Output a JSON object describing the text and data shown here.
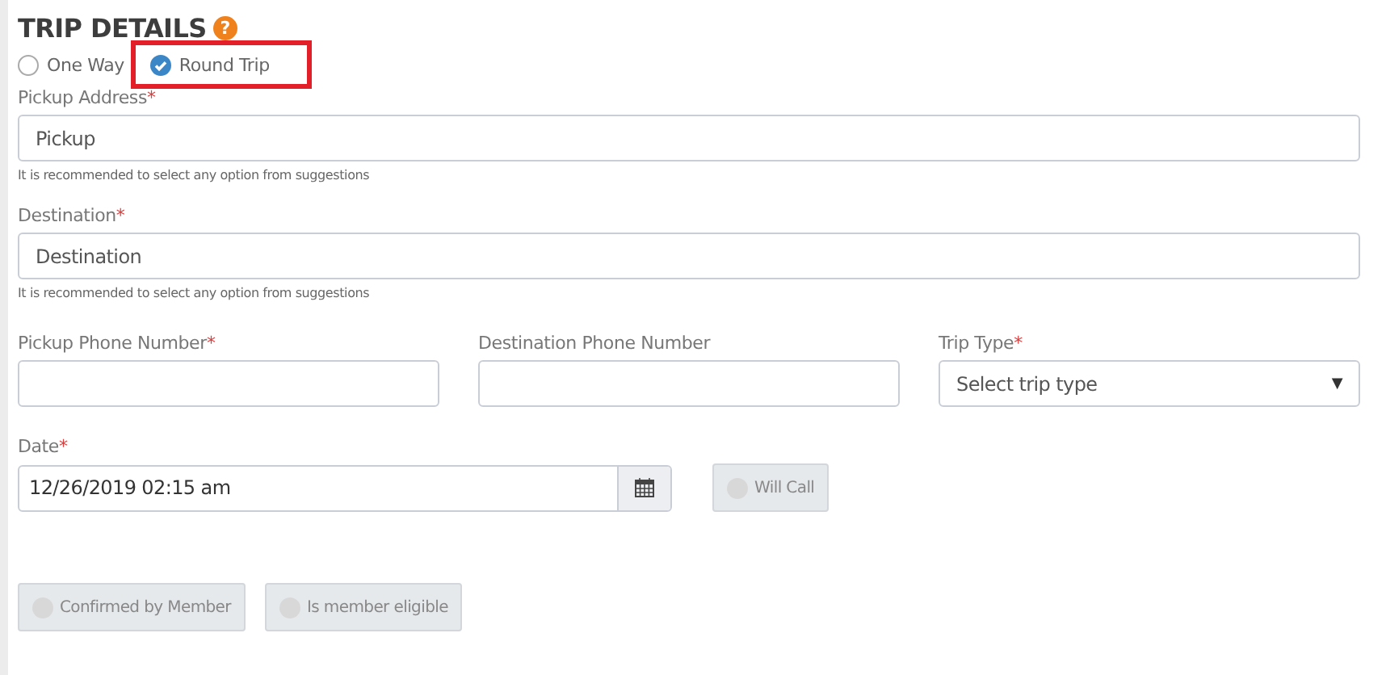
{
  "section": {
    "title": "TRIP DETAILS",
    "help_icon": "?"
  },
  "trip_mode": [
    {
      "label": "One Way",
      "selected": false,
      "highlighted": false
    },
    {
      "label": "Round Trip",
      "selected": true,
      "highlighted": true
    }
  ],
  "pickup_address": {
    "label": "Pickup Address",
    "required_mark": "*",
    "placeholder": "Pickup",
    "hint": "It is recommended to select any option from suggestions"
  },
  "destination": {
    "label": "Destination",
    "required_mark": "*",
    "placeholder": "Destination",
    "hint": "It is recommended to select any option from suggestions"
  },
  "row_fields": [
    {
      "kind": "input",
      "label": "Pickup Phone Number",
      "required_mark": "*"
    },
    {
      "kind": "input",
      "label": "Destination Phone Number"
    },
    {
      "kind": "select",
      "label": "Trip Type",
      "required_mark": "*",
      "value": "Select trip type",
      "caret": "▼"
    }
  ],
  "date": {
    "label": "Date",
    "required_mark": "*",
    "value": "12/26/2019 02:15 am"
  },
  "will_call": {
    "label": "Will Call",
    "checked": false
  },
  "toggles": [
    {
      "label": "Confirmed by Member",
      "checked": false
    },
    {
      "label": "Is member eligible",
      "checked": false
    }
  ]
}
